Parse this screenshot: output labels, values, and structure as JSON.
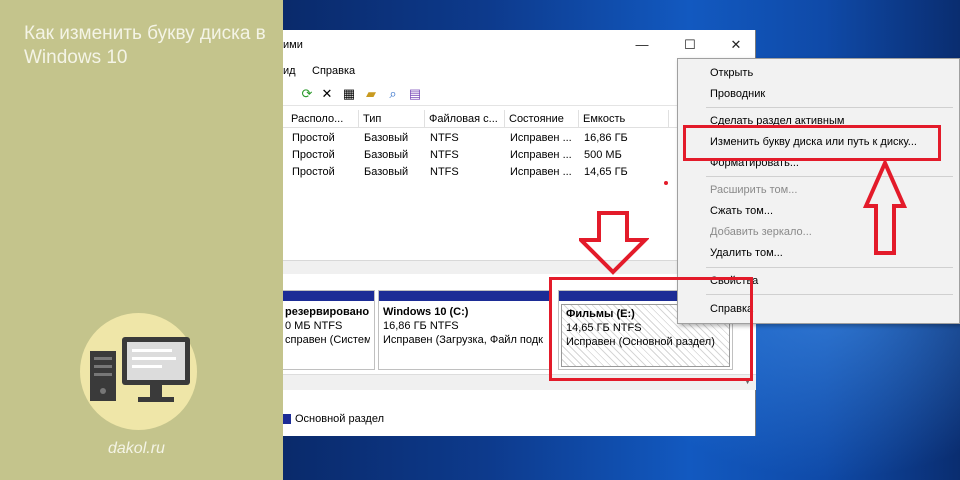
{
  "banner": {
    "title": "Как изменить букву диска в Windows 10",
    "site": "dakol.ru"
  },
  "window": {
    "title_fragment": "ими",
    "minimize_icon": "minimize-icon",
    "maximize_icon": "maximize-icon",
    "close_icon": "close-icon",
    "menu": [
      "ид",
      "Справка"
    ]
  },
  "table": {
    "columns": [
      "Располо...",
      "Тип",
      "Файловая с...",
      "Состояние",
      "Емкость"
    ],
    "rows": [
      [
        "Простой",
        "Базовый",
        "NTFS",
        "Исправен ...",
        "16,86 ГБ"
      ],
      [
        "Простой",
        "Базовый",
        "NTFS",
        "Исправен ...",
        "500 МБ"
      ],
      [
        "Простой",
        "Базовый",
        "NTFS",
        "Исправен ...",
        "14,65 ГБ"
      ]
    ]
  },
  "partitions": [
    {
      "name": "резервировано",
      "size": "0 МБ NTFS",
      "status": "справен (Систем"
    },
    {
      "name": "Windows 10  (C:)",
      "size": "16,86 ГБ NTFS",
      "status": "Исправен (Загрузка, Файл подк"
    },
    {
      "name": "Фильмы  (E:)",
      "size": "14,65 ГБ NTFS",
      "status": "Исправен (Основной раздел)"
    }
  ],
  "legend": {
    "label": "Основной раздел",
    "color": "#1c2c96"
  },
  "context_menu": {
    "open": "Открыть",
    "explorer": "Проводник",
    "make_active": "Сделать раздел активным",
    "change_letter": "Изменить букву диска или путь к диску...",
    "format": "Форматировать...",
    "extend": "Расширить том...",
    "shrink": "Сжать том...",
    "add_mirror": "Добавить зеркало...",
    "delete": "Удалить том...",
    "properties": "Свойства",
    "help": "Справка"
  },
  "colors": {
    "accent_red": "#e31b2a",
    "banner": "#c4c48c"
  }
}
